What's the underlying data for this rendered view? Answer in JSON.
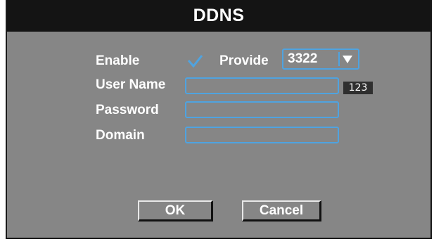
{
  "dialog": {
    "title": "DDNS"
  },
  "form": {
    "enable_label": "Enable",
    "enable_checked": true,
    "provide_label": "Provide",
    "provide_value": "3322",
    "username_label": "User Name",
    "username_value": "",
    "password_label": "Password",
    "password_value": "",
    "domain_label": "Domain",
    "domain_value": "",
    "keyboard_badge": "123"
  },
  "buttons": {
    "ok_label": "OK",
    "cancel_label": "Cancel"
  },
  "colors": {
    "panel_bg": "#868686",
    "titlebar_bg": "#141414",
    "accent_border": "#4fa3e0",
    "text": "#ffffff"
  },
  "icons": {
    "checkbox": "checkmark-icon",
    "dropdown": "triangle-down-icon"
  }
}
